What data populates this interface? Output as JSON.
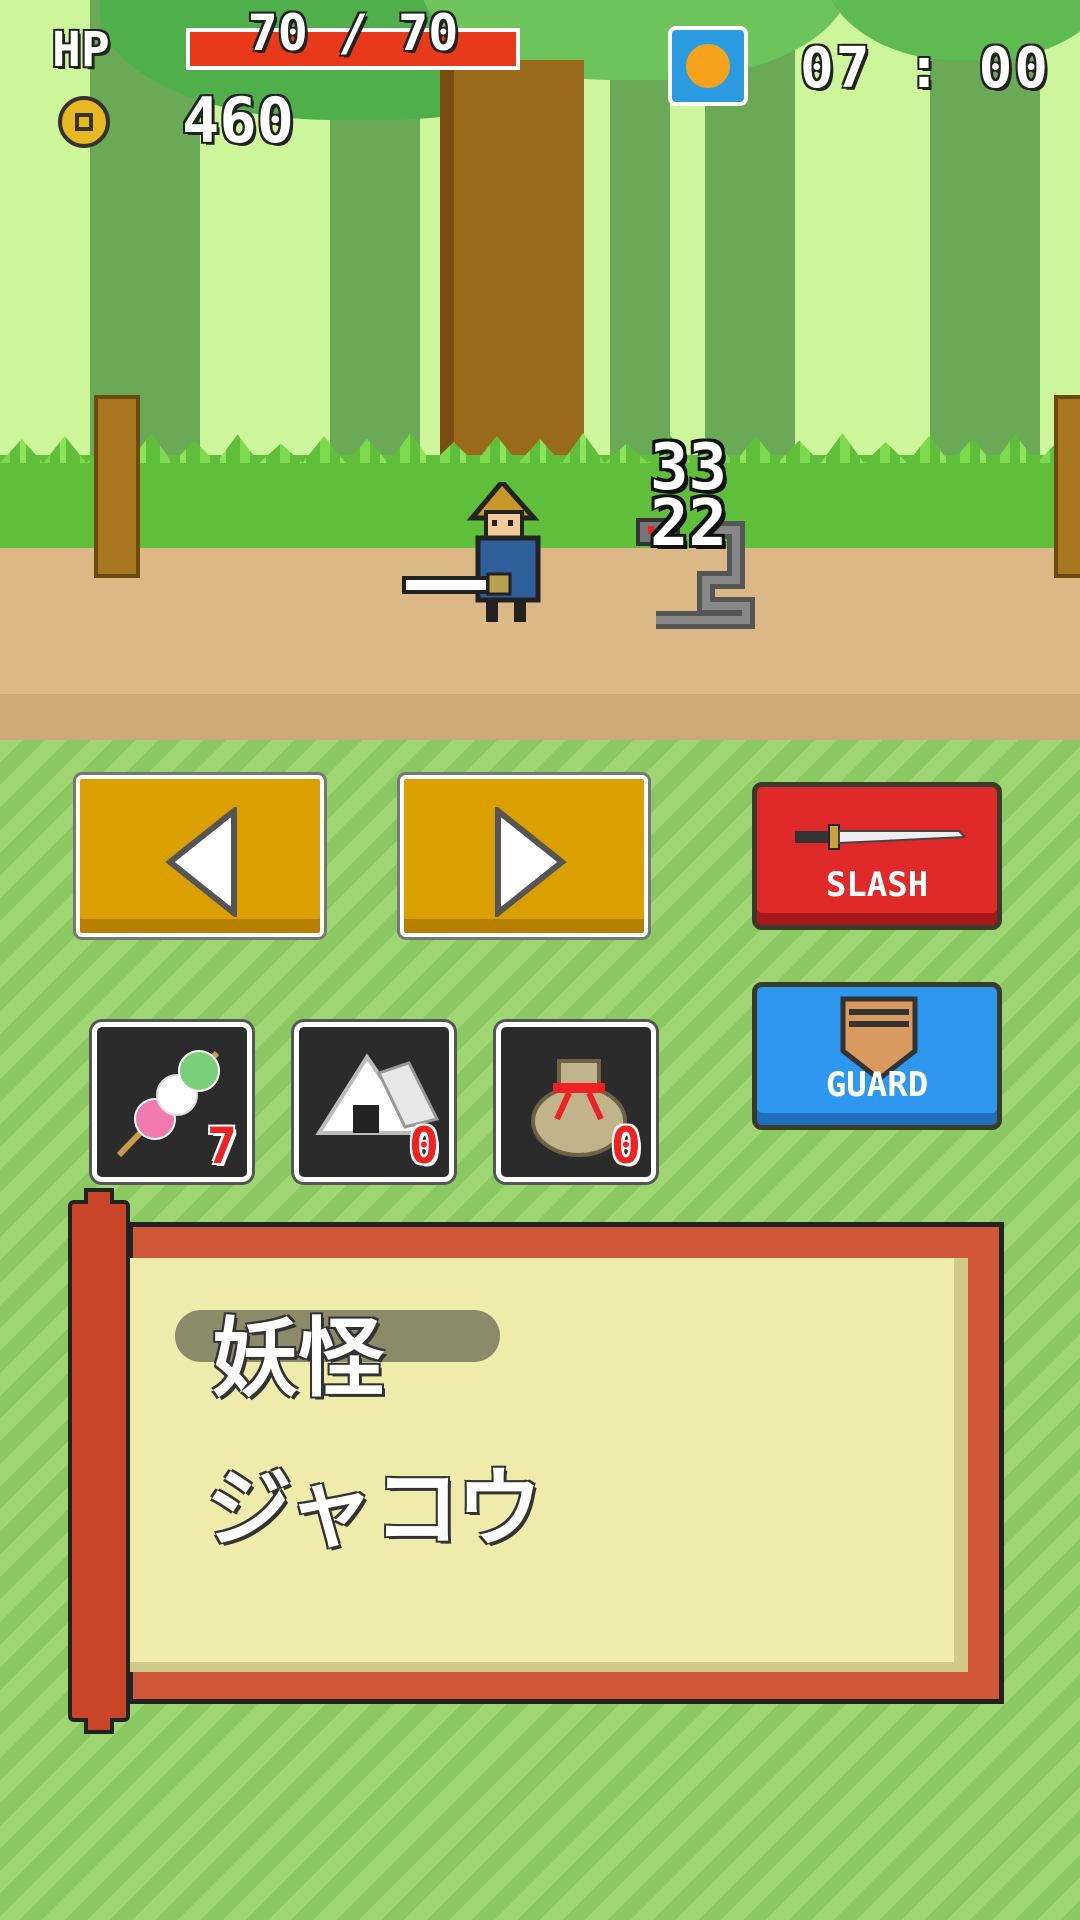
{
  "hud": {
    "hp_label": "HP",
    "hp_current": 70,
    "hp_max": 70,
    "hp_text": "70 / 70",
    "money": "460",
    "time": "07 : 00",
    "time_of_day_icon": "sun-icon"
  },
  "battle": {
    "damage_numbers": [
      "33",
      "22"
    ]
  },
  "controls": {
    "left_icon": "arrow-left-icon",
    "right_icon": "arrow-right-icon",
    "slash_label": "SLASH",
    "guard_label": "GUARD"
  },
  "items": [
    {
      "icon": "dango-icon",
      "count": "7"
    },
    {
      "icon": "onigiri-icon",
      "count": "0"
    },
    {
      "icon": "pouch-icon",
      "count": "0"
    }
  ],
  "info_scroll": {
    "category": "妖怪",
    "enemy_name": "ジャコウ"
  },
  "colors": {
    "sky": "#cdf59a",
    "hp_bar": "#e83a1a",
    "slash_button": "#e02a2a",
    "guard_button": "#2e98f0",
    "arrow_button": "#d9a000",
    "scroll_frame": "#d0573a",
    "scroll_paper": "#efecab"
  }
}
